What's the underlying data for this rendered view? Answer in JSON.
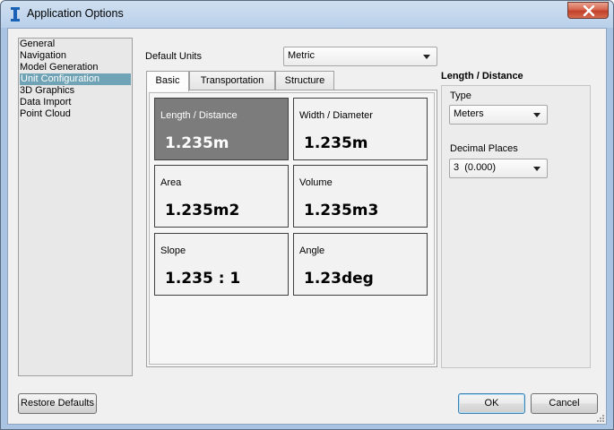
{
  "window": {
    "title": "Application Options",
    "icon": "app-i-icon",
    "close_icon": "close-icon"
  },
  "nav": {
    "items": [
      {
        "label": "General",
        "selected": false
      },
      {
        "label": "Navigation",
        "selected": false
      },
      {
        "label": "Model Generation",
        "selected": false
      },
      {
        "label": "Unit Configuration",
        "selected": true
      },
      {
        "label": "3D Graphics",
        "selected": false
      },
      {
        "label": "Data Import",
        "selected": false
      },
      {
        "label": "Point Cloud",
        "selected": false
      }
    ]
  },
  "default_units": {
    "label": "Default Units",
    "value": "Metric"
  },
  "tabs": [
    {
      "label": "Basic",
      "active": true
    },
    {
      "label": "Transportation",
      "active": false
    },
    {
      "label": "Structure",
      "active": false
    }
  ],
  "tiles": [
    {
      "label": "Length / Distance",
      "value": "1.235m",
      "selected": true
    },
    {
      "label": "Width / Diameter",
      "value": "1.235m",
      "selected": false
    },
    {
      "label": "Area",
      "value": "1.235m2",
      "selected": false
    },
    {
      "label": "Volume",
      "value": "1.235m3",
      "selected": false
    },
    {
      "label": "Slope",
      "value": "1.235 : 1",
      "selected": false
    },
    {
      "label": "Angle",
      "value": "1.23deg",
      "selected": false
    }
  ],
  "properties": {
    "title": "Length / Distance",
    "type_label": "Type",
    "type_value": "Meters",
    "decimal_label": "Decimal Places",
    "decimal_value": "3  (0.000)"
  },
  "buttons": {
    "restore": "Restore Defaults",
    "ok": "OK",
    "cancel": "Cancel"
  },
  "colors": {
    "selected_nav": "#6fa3b5",
    "selected_tile": "#7c7c7c",
    "title_bar": "#b9d0ea",
    "close_button": "#c7432c"
  }
}
